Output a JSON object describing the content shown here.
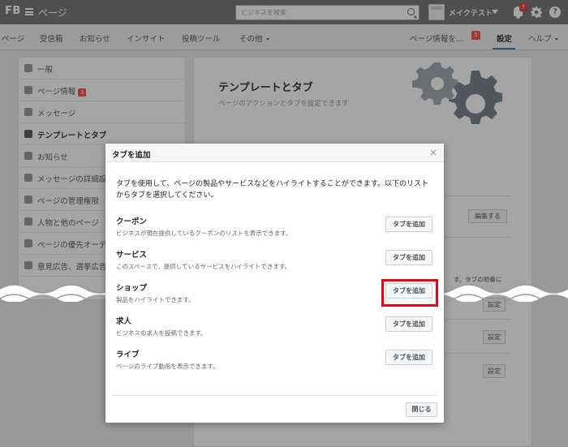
{
  "topbar": {
    "brand": "FB",
    "page_label": "ページ",
    "search_placeholder": "ビジネスを検索",
    "account_name": "メイクテスト",
    "notification_count": "7"
  },
  "subnav": {
    "items": [
      "ページ",
      "受信箱",
      "お知らせ",
      "インサイト",
      "投稿ツール",
      "その他"
    ],
    "page_info": "ページ情報を...",
    "page_info_badge": "5",
    "settings": "設定",
    "help": "ヘルプ"
  },
  "sidebar": {
    "items": [
      {
        "label": "一般"
      },
      {
        "label": "ページ情報",
        "badge": "3"
      },
      {
        "label": "メッセージ"
      },
      {
        "label": "テンプレートとタブ"
      },
      {
        "label": "お知らせ"
      },
      {
        "label": "メッセージの詳細設"
      },
      {
        "label": "ページの管理権限"
      },
      {
        "label": "人物と他のページ"
      },
      {
        "label": "ページの優先オーデ"
      },
      {
        "label": "意見広告、選挙広告"
      }
    ]
  },
  "main": {
    "title": "テンプレートとタブ",
    "subtitle": "ページのアクションとタブを設定できます",
    "edit_label": "編集する",
    "note": "す。タブの順番に",
    "settings_label": "設定"
  },
  "modal": {
    "title": "タブを追加",
    "close_glyph": "×",
    "intro": "タブを使用して、ページの製品やサービスなどをハイライトすることができます。以下のリストからタブを選択してください。",
    "tabs": [
      {
        "name": "クーポン",
        "description": "ビジネスが現在提供しているクーポンのリストを表示できます。",
        "button": "タブを追加"
      },
      {
        "name": "サービス",
        "description": "このスペースで、提供しているサービスをハイライトできます。",
        "button": "タブを追加"
      },
      {
        "name": "ショップ",
        "description": "製品をハイライトできます。",
        "button": "タブを追加"
      },
      {
        "name": "求人",
        "description": "ビジネスの求人を投稿できます。",
        "button": "タブを追加"
      },
      {
        "name": "ライブ",
        "description": "ページのライブ動画を表示できます。",
        "button": "タブを追加"
      }
    ],
    "close_button": "閉じる"
  },
  "colors": {
    "topbar": "#6b6b6b",
    "highlight": "#e8001a",
    "badge": "#fa3e3e"
  }
}
